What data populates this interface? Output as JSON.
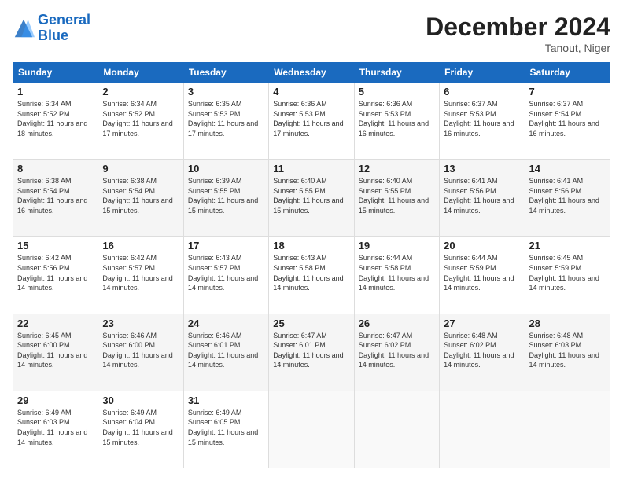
{
  "header": {
    "logo_line1": "General",
    "logo_line2": "Blue",
    "title": "December 2024",
    "location": "Tanout, Niger"
  },
  "weekdays": [
    "Sunday",
    "Monday",
    "Tuesday",
    "Wednesday",
    "Thursday",
    "Friday",
    "Saturday"
  ],
  "weeks": [
    [
      {
        "day": "1",
        "info": "Sunrise: 6:34 AM\nSunset: 5:52 PM\nDaylight: 11 hours and 18 minutes."
      },
      {
        "day": "2",
        "info": "Sunrise: 6:34 AM\nSunset: 5:52 PM\nDaylight: 11 hours and 17 minutes."
      },
      {
        "day": "3",
        "info": "Sunrise: 6:35 AM\nSunset: 5:53 PM\nDaylight: 11 hours and 17 minutes."
      },
      {
        "day": "4",
        "info": "Sunrise: 6:36 AM\nSunset: 5:53 PM\nDaylight: 11 hours and 17 minutes."
      },
      {
        "day": "5",
        "info": "Sunrise: 6:36 AM\nSunset: 5:53 PM\nDaylight: 11 hours and 16 minutes."
      },
      {
        "day": "6",
        "info": "Sunrise: 6:37 AM\nSunset: 5:53 PM\nDaylight: 11 hours and 16 minutes."
      },
      {
        "day": "7",
        "info": "Sunrise: 6:37 AM\nSunset: 5:54 PM\nDaylight: 11 hours and 16 minutes."
      }
    ],
    [
      {
        "day": "8",
        "info": "Sunrise: 6:38 AM\nSunset: 5:54 PM\nDaylight: 11 hours and 16 minutes."
      },
      {
        "day": "9",
        "info": "Sunrise: 6:38 AM\nSunset: 5:54 PM\nDaylight: 11 hours and 15 minutes."
      },
      {
        "day": "10",
        "info": "Sunrise: 6:39 AM\nSunset: 5:55 PM\nDaylight: 11 hours and 15 minutes."
      },
      {
        "day": "11",
        "info": "Sunrise: 6:40 AM\nSunset: 5:55 PM\nDaylight: 11 hours and 15 minutes."
      },
      {
        "day": "12",
        "info": "Sunrise: 6:40 AM\nSunset: 5:55 PM\nDaylight: 11 hours and 15 minutes."
      },
      {
        "day": "13",
        "info": "Sunrise: 6:41 AM\nSunset: 5:56 PM\nDaylight: 11 hours and 14 minutes."
      },
      {
        "day": "14",
        "info": "Sunrise: 6:41 AM\nSunset: 5:56 PM\nDaylight: 11 hours and 14 minutes."
      }
    ],
    [
      {
        "day": "15",
        "info": "Sunrise: 6:42 AM\nSunset: 5:56 PM\nDaylight: 11 hours and 14 minutes."
      },
      {
        "day": "16",
        "info": "Sunrise: 6:42 AM\nSunset: 5:57 PM\nDaylight: 11 hours and 14 minutes."
      },
      {
        "day": "17",
        "info": "Sunrise: 6:43 AM\nSunset: 5:57 PM\nDaylight: 11 hours and 14 minutes."
      },
      {
        "day": "18",
        "info": "Sunrise: 6:43 AM\nSunset: 5:58 PM\nDaylight: 11 hours and 14 minutes."
      },
      {
        "day": "19",
        "info": "Sunrise: 6:44 AM\nSunset: 5:58 PM\nDaylight: 11 hours and 14 minutes."
      },
      {
        "day": "20",
        "info": "Sunrise: 6:44 AM\nSunset: 5:59 PM\nDaylight: 11 hours and 14 minutes."
      },
      {
        "day": "21",
        "info": "Sunrise: 6:45 AM\nSunset: 5:59 PM\nDaylight: 11 hours and 14 minutes."
      }
    ],
    [
      {
        "day": "22",
        "info": "Sunrise: 6:45 AM\nSunset: 6:00 PM\nDaylight: 11 hours and 14 minutes."
      },
      {
        "day": "23",
        "info": "Sunrise: 6:46 AM\nSunset: 6:00 PM\nDaylight: 11 hours and 14 minutes."
      },
      {
        "day": "24",
        "info": "Sunrise: 6:46 AM\nSunset: 6:01 PM\nDaylight: 11 hours and 14 minutes."
      },
      {
        "day": "25",
        "info": "Sunrise: 6:47 AM\nSunset: 6:01 PM\nDaylight: 11 hours and 14 minutes."
      },
      {
        "day": "26",
        "info": "Sunrise: 6:47 AM\nSunset: 6:02 PM\nDaylight: 11 hours and 14 minutes."
      },
      {
        "day": "27",
        "info": "Sunrise: 6:48 AM\nSunset: 6:02 PM\nDaylight: 11 hours and 14 minutes."
      },
      {
        "day": "28",
        "info": "Sunrise: 6:48 AM\nSunset: 6:03 PM\nDaylight: 11 hours and 14 minutes."
      }
    ],
    [
      {
        "day": "29",
        "info": "Sunrise: 6:49 AM\nSunset: 6:03 PM\nDaylight: 11 hours and 14 minutes."
      },
      {
        "day": "30",
        "info": "Sunrise: 6:49 AM\nSunset: 6:04 PM\nDaylight: 11 hours and 15 minutes."
      },
      {
        "day": "31",
        "info": "Sunrise: 6:49 AM\nSunset: 6:05 PM\nDaylight: 11 hours and 15 minutes."
      },
      null,
      null,
      null,
      null
    ]
  ]
}
